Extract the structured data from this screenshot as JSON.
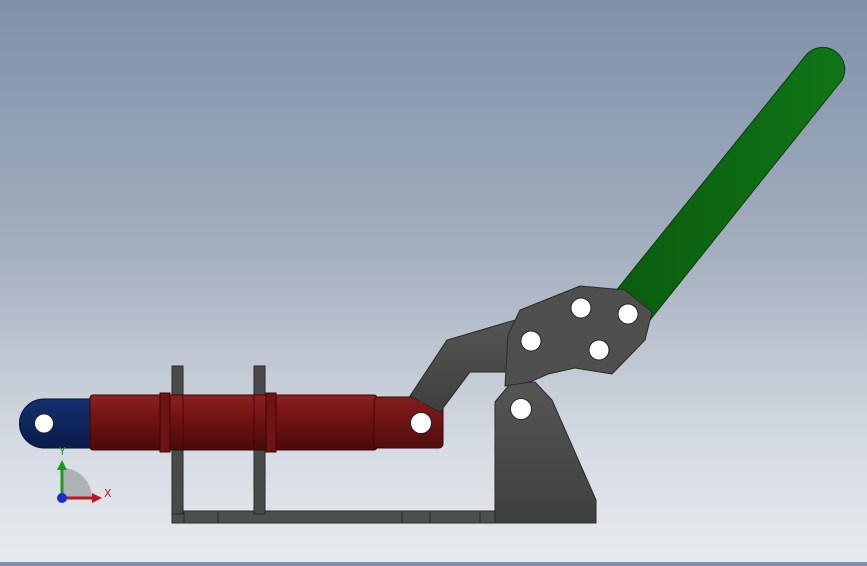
{
  "viewport": {
    "background_top": "#7f90a8",
    "background_bottom": "#e7eaee"
  },
  "model": {
    "parts": [
      {
        "name": "cylinder-barrel",
        "color": "#7a1515"
      },
      {
        "name": "piston-rod",
        "color": "#7a1515"
      },
      {
        "name": "rod-eye-end",
        "color": "#0d2460"
      },
      {
        "name": "linkage-arm",
        "color": "#4a4a48"
      },
      {
        "name": "pivot-bracket",
        "color": "#4a4a48"
      },
      {
        "name": "base-frame",
        "color": "#4f4f4d"
      },
      {
        "name": "handle",
        "color": "#0f6b14"
      }
    ]
  },
  "triad": {
    "x_label": "X",
    "y_label": "Y",
    "x_color": "#c0171c",
    "y_color": "#1a9e1a",
    "z_color": "#1c2bc8"
  }
}
